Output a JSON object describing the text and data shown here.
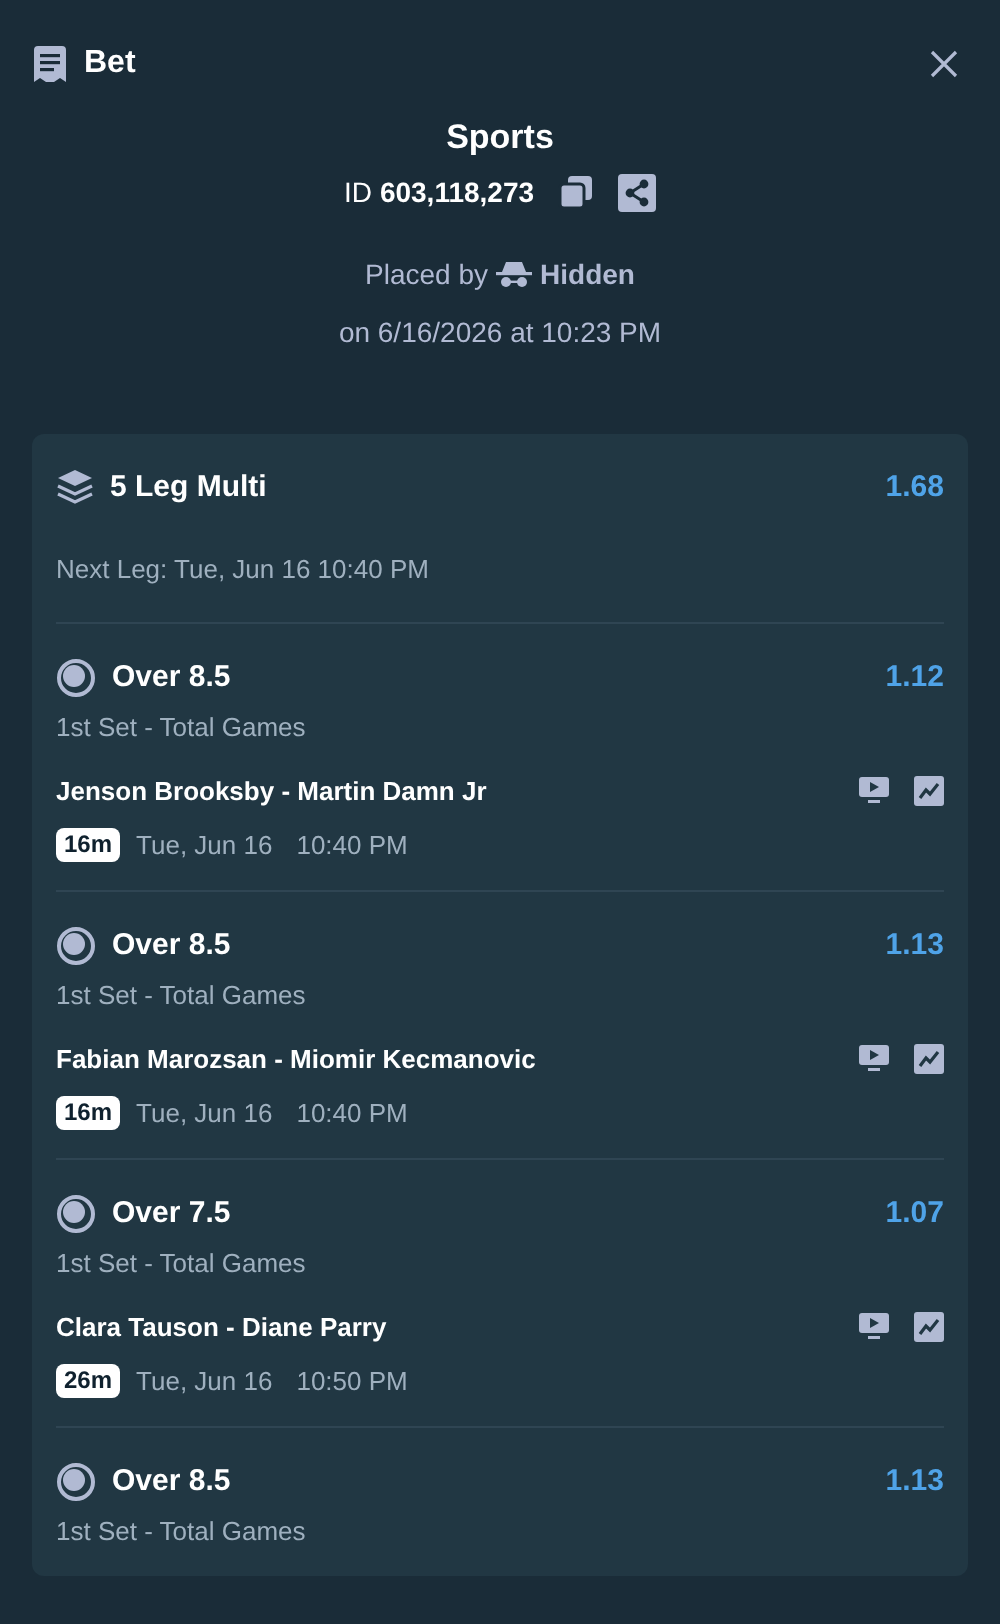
{
  "header": {
    "title": "Bet"
  },
  "summary": {
    "category": "Sports",
    "id_label": "ID",
    "id_value": "603,118,273",
    "placed_by_label": "Placed by",
    "placed_by": "Hidden",
    "placed_on": "on 6/16/2026 at 10:23 PM"
  },
  "multi": {
    "title": "5 Leg Multi",
    "odds": "1.68",
    "next_leg": "Next Leg: Tue, Jun 16 10:40 PM"
  },
  "legs": [
    {
      "selection": "Over 8.5",
      "odds": "1.12",
      "market": "1st Set - Total Games",
      "match": "Jenson Brooksby - Martin Damn Jr",
      "countdown": "16m",
      "date": "Tue, Jun 16",
      "time": "10:40 PM"
    },
    {
      "selection": "Over 8.5",
      "odds": "1.13",
      "market": "1st Set - Total Games",
      "match": "Fabian Marozsan - Miomir Kecmanovic",
      "countdown": "16m",
      "date": "Tue, Jun 16",
      "time": "10:40 PM"
    },
    {
      "selection": "Over 7.5",
      "odds": "1.07",
      "market": "1st Set - Total Games",
      "match": "Clara Tauson - Diane Parry",
      "countdown": "26m",
      "date": "Tue, Jun 16",
      "time": "10:50 PM"
    },
    {
      "selection": "Over 8.5",
      "odds": "1.13",
      "market": "1st Set - Total Games"
    }
  ]
}
